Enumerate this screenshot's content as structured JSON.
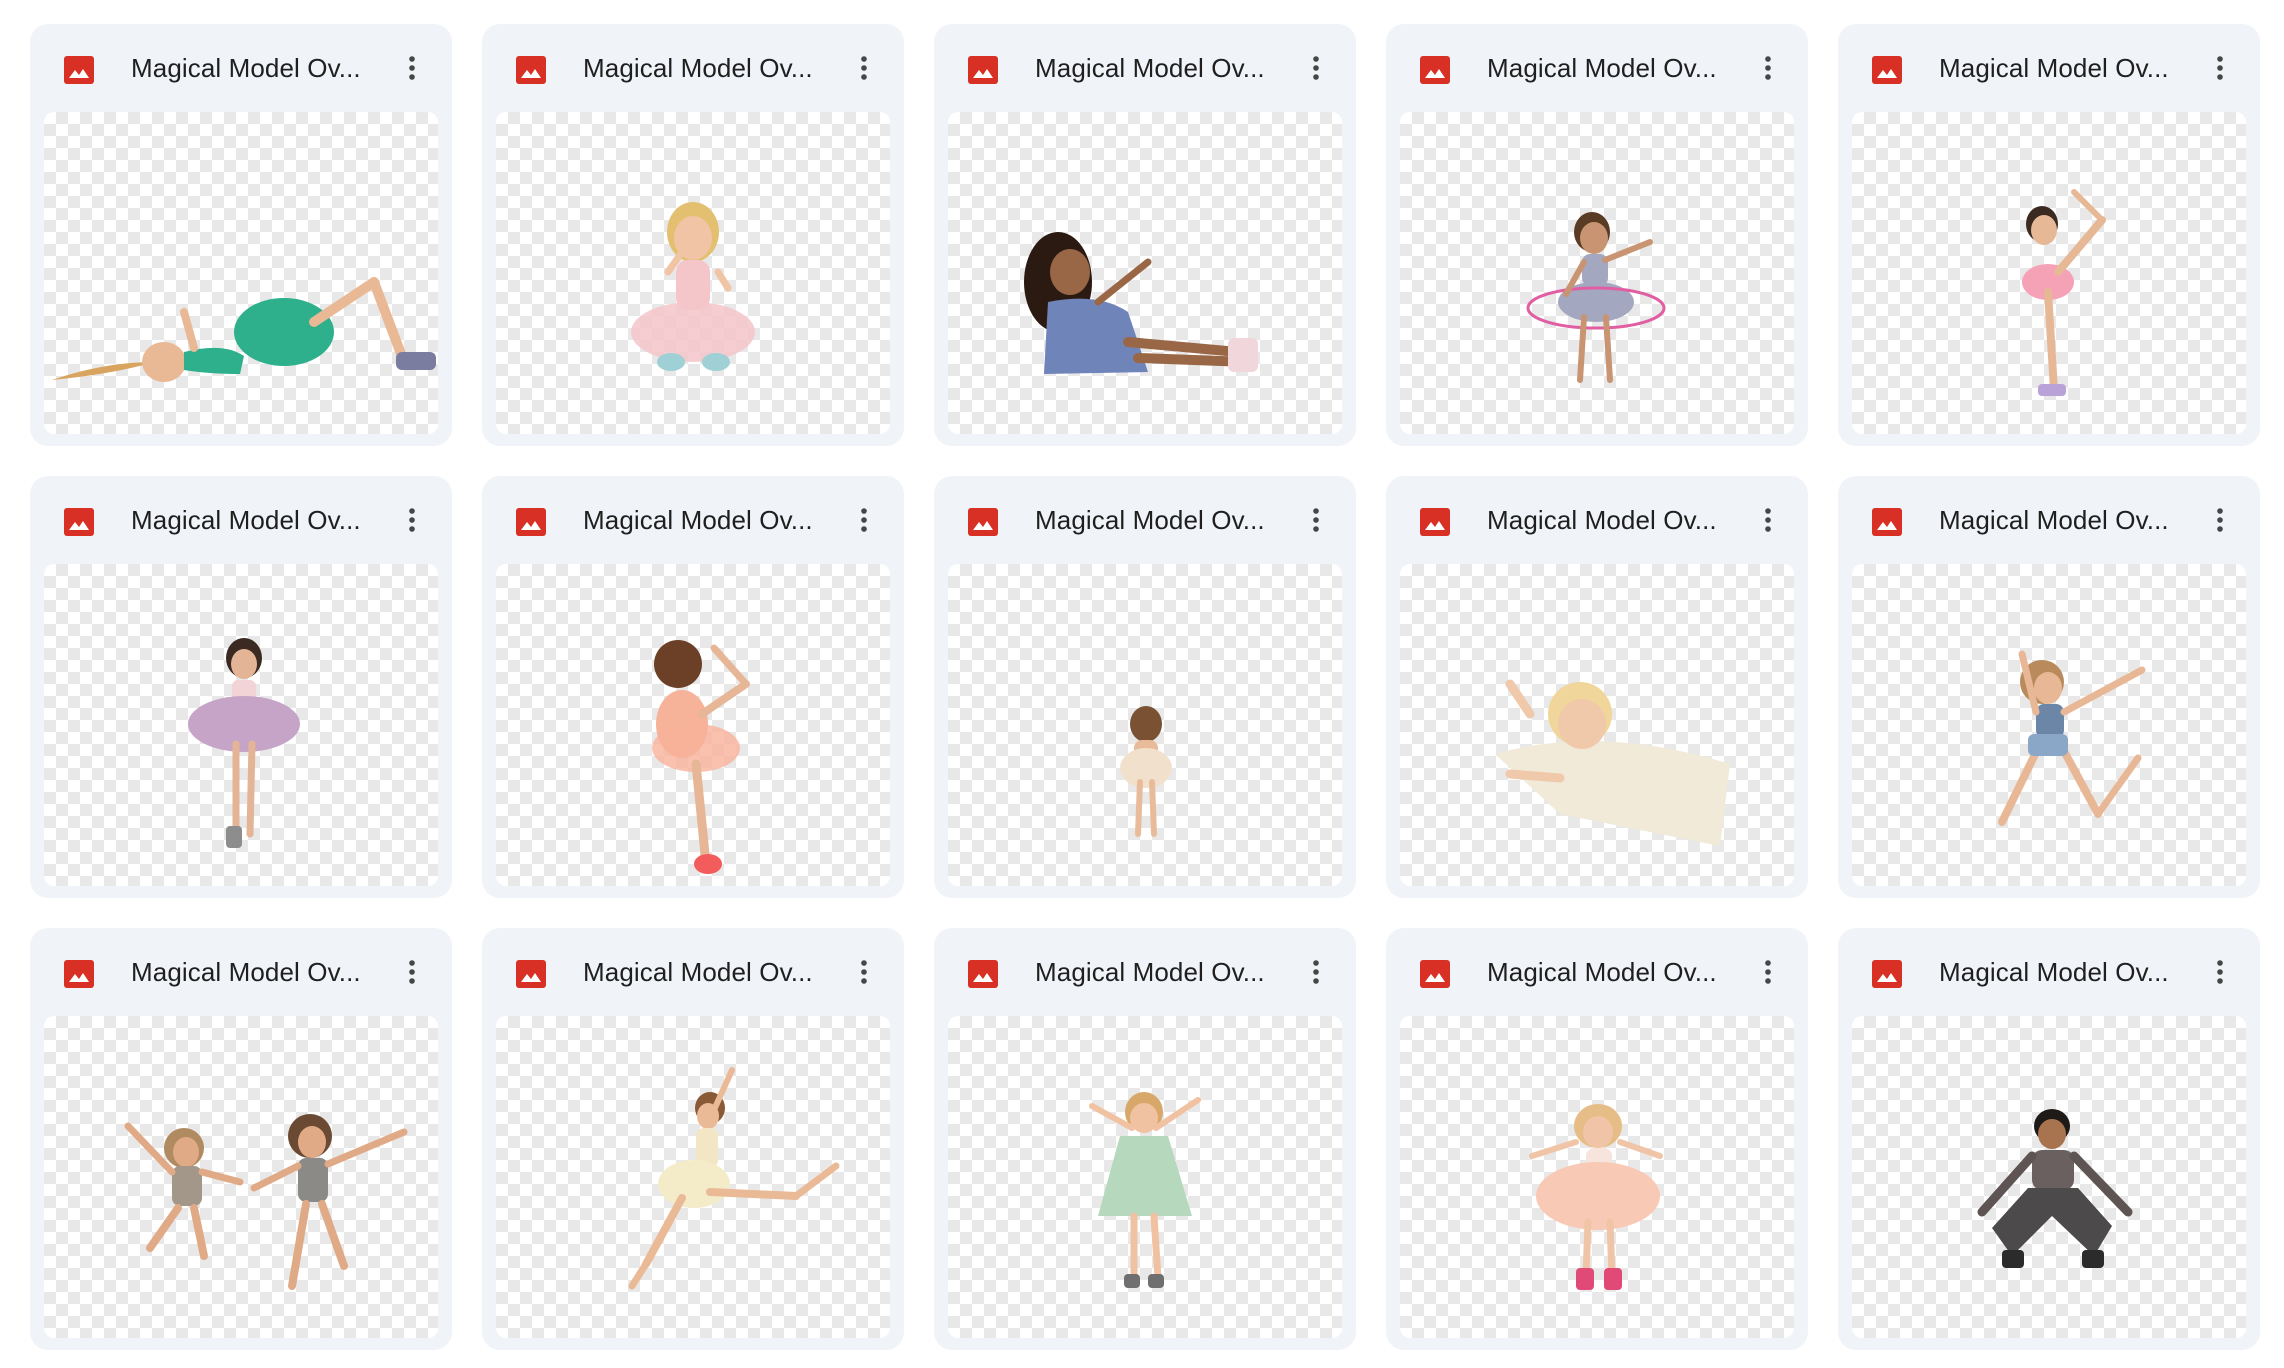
{
  "files": [
    {
      "name": "Magical Model Ov...",
      "subject": "girl-lying-green-tutu",
      "dress": "#2fb08c",
      "hair": "#d9a45f",
      "skin": "#e9b895",
      "pose": "lying"
    },
    {
      "name": "Magical Model Ov...",
      "subject": "girl-sitting-cupcakes",
      "dress": "#f4c6c9",
      "hair": "#e2c06f",
      "skin": "#f0c4a5",
      "pose": "sitting-cross"
    },
    {
      "name": "Magical Model Ov...",
      "subject": "girl-sitting-blue-dress",
      "dress": "#6f84b8",
      "hair": "#2b1a12",
      "skin": "#9a6746",
      "pose": "sitting-legs"
    },
    {
      "name": "Magical Model Ov...",
      "subject": "girl-hula-hoop",
      "dress": "#a4a7c0",
      "hair": "#5a3b24",
      "skin": "#c99472",
      "pose": "hoop"
    },
    {
      "name": "Magical Model Ov...",
      "subject": "girl-leg-stretch-pink",
      "dress": "#f5a2b6",
      "hair": "#3a2a22",
      "skin": "#e6b896",
      "pose": "stretch"
    },
    {
      "name": "Magical Model Ov...",
      "subject": "girl-standing-purple-tutu",
      "dress": "#c6a4c8",
      "hair": "#3a2a22",
      "skin": "#e4b496",
      "pose": "stand-tutu"
    },
    {
      "name": "Magical Model Ov...",
      "subject": "girl-ballet-back-orange",
      "dress": "#f7b29a",
      "hair": "#6b4026",
      "skin": "#e6b696",
      "pose": "ballet-back"
    },
    {
      "name": "Magical Model Ov...",
      "subject": "small-girl-walking",
      "dress": "#f1e1cc",
      "hair": "#7a5132",
      "skin": "#e8bc9b",
      "pose": "small-walk"
    },
    {
      "name": "Magical Model Ov...",
      "subject": "toddler-lying-tutu",
      "dress": "#f1ead8",
      "hair": "#f0d69a",
      "skin": "#f0c8aa",
      "pose": "lying-front"
    },
    {
      "name": "Magical Model Ov...",
      "subject": "girl-jumping-denim",
      "dress": "#6b86a6",
      "hair": "#b88a5c",
      "skin": "#e8b896",
      "pose": "jump"
    },
    {
      "name": "Magical Model Ov...",
      "subject": "two-girls-jumping",
      "dress": "#8c8a86",
      "hair": "#6b4a34",
      "skin": "#e0aa86",
      "pose": "two-jump"
    },
    {
      "name": "Magical Model Ov...",
      "subject": "girl-leaping-cream",
      "dress": "#f4ecc8",
      "hair": "#8a5a36",
      "skin": "#eab996",
      "pose": "leap"
    },
    {
      "name": "Magical Model Ov...",
      "subject": "girl-jump-green-dress",
      "dress": "#b6d8bc",
      "hair": "#d8a86a",
      "skin": "#f0c2a2",
      "pose": "jump-dress"
    },
    {
      "name": "Magical Model Ov...",
      "subject": "girl-jump-peach-tutu",
      "dress": "#f8c9b4",
      "hair": "#e6bd86",
      "skin": "#f0c4a6",
      "pose": "jump-tutu"
    },
    {
      "name": "Magical Model Ov...",
      "subject": "boy-jumping-plaid",
      "dress": "#4c4a4a",
      "hair": "#1e1a18",
      "skin": "#a87450",
      "pose": "boy-jump"
    }
  ],
  "icon": {
    "name": "image-file-icon",
    "color": "#d93025"
  },
  "more_icon": "more-vert-icon"
}
